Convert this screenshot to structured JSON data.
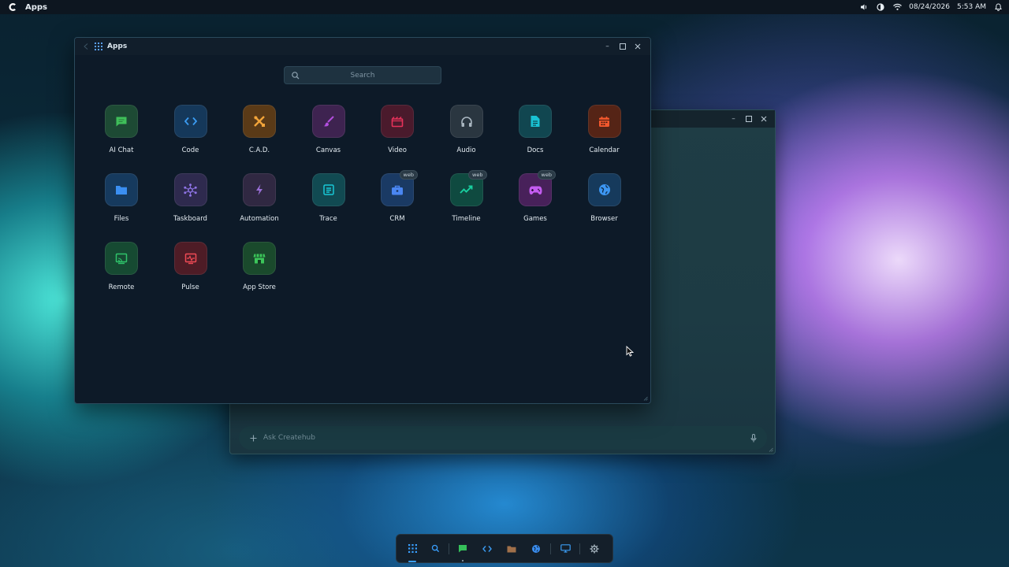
{
  "topbar": {
    "app_title": "Apps",
    "date": "08/24/2026",
    "time": "5:53 AM",
    "icons": [
      "createhub-logo-icon",
      "volume-icon",
      "brightness-icon",
      "wifi-icon",
      "notification-bell-icon"
    ]
  },
  "apps_window": {
    "title": "Apps",
    "search_placeholder": "Search",
    "apps": [
      {
        "label": "AI Chat",
        "icon": "chat-bubble-icon",
        "color": "#3fbf5a",
        "bg": "#1d4a34"
      },
      {
        "label": "Code",
        "icon": "code-brackets-icon",
        "color": "#3b9cf2",
        "bg": "#15385a"
      },
      {
        "label": "C.A.D.",
        "icon": "cad-tools-icon",
        "color": "#f2a43a",
        "bg": "#5a3a17"
      },
      {
        "label": "Canvas",
        "icon": "paintbrush-icon",
        "color": "#b44fe0",
        "bg": "#3e2350"
      },
      {
        "label": "Video",
        "icon": "clapperboard-icon",
        "color": "#e6325a",
        "bg": "#4a1a2c"
      },
      {
        "label": "Audio",
        "icon": "headphones-icon",
        "color": "#a9b6c0",
        "bg": "#2a3640"
      },
      {
        "label": "Docs",
        "icon": "document-icon",
        "color": "#19c2d4",
        "bg": "#114650"
      },
      {
        "label": "Calendar",
        "icon": "calendar-icon",
        "color": "#f2582d",
        "bg": "#552416"
      },
      {
        "label": "Files",
        "icon": "folder-icon",
        "color": "#3b8ff2",
        "bg": "#163a5e"
      },
      {
        "label": "Taskboard",
        "icon": "taskboard-nodes-icon",
        "color": "#8f74e6",
        "bg": "#2e2a4e"
      },
      {
        "label": "Automation",
        "icon": "lightning-icon",
        "color": "#9a6fd8",
        "bg": "#302842"
      },
      {
        "label": "Trace",
        "icon": "trace-chip-icon",
        "color": "#19c7d6",
        "bg": "#114a52"
      },
      {
        "label": "CRM",
        "icon": "briefcase-icon",
        "color": "#4a86f2",
        "bg": "#1a3a64",
        "badge": "web"
      },
      {
        "label": "Timeline",
        "icon": "trend-line-icon",
        "color": "#18d0a0",
        "bg": "#0f4a40",
        "badge": "web"
      },
      {
        "label": "Games",
        "icon": "gamepad-icon",
        "color": "#c45cf0",
        "bg": "#48215a",
        "badge": "web"
      },
      {
        "label": "Browser",
        "icon": "globe-icon",
        "color": "#3c96f2",
        "bg": "#163a5c"
      },
      {
        "label": "Remote",
        "icon": "remote-cast-icon",
        "color": "#2fc46a",
        "bg": "#164a32"
      },
      {
        "label": "Pulse",
        "icon": "pulse-monitor-icon",
        "color": "#ef4a55",
        "bg": "#4e1c26"
      },
      {
        "label": "App Store",
        "icon": "storefront-icon",
        "color": "#3cc65a",
        "bg": "#1a4a2c"
      }
    ]
  },
  "chat_window": {
    "placeholder": "Ask Createhub"
  },
  "dock": {
    "items": [
      "apps-grid-icon",
      "search-icon",
      "chat-bubble-icon",
      "code-brackets-icon",
      "folder-icon",
      "globe-icon",
      "monitor-icon",
      "settings-gear-icon"
    ]
  }
}
